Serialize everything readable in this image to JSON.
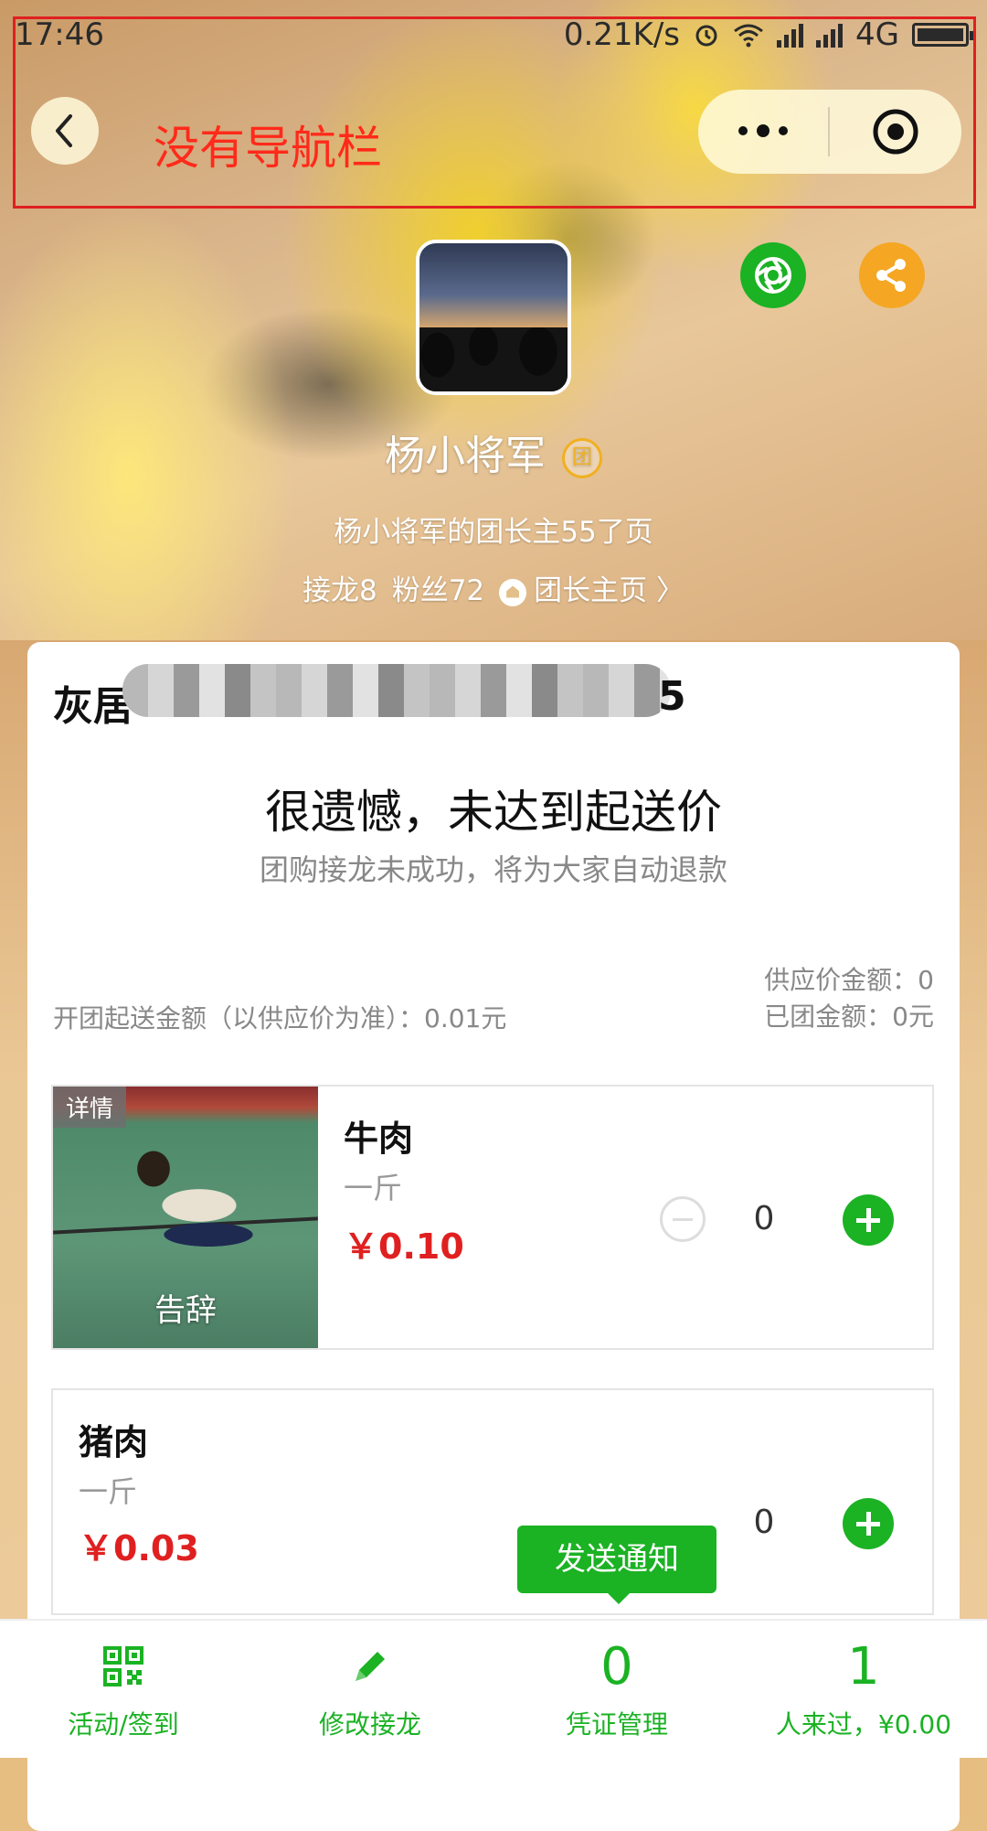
{
  "status_bar": {
    "time": "17:46",
    "speed": "0.21K/s",
    "network": "4G"
  },
  "annotation": {
    "text": "没有导航栏",
    "color": "#ff2a1a"
  },
  "profile": {
    "name": "杨小将军",
    "badge": "团",
    "description": "杨小将军的团长主55了页",
    "relay_count_label": "接龙8",
    "fans_label": "粉丝72",
    "home_link": "团长主页 〉"
  },
  "card": {
    "title_prefix": "灰居",
    "title_suffix": "5",
    "fail_title": "很遗憾，未达到起送价",
    "fail_subtitle": "团购接龙未成功，将为大家自动退款",
    "min_amount": "开团起送金额（以供应价为准）：0.01元",
    "supply_amount": "供应价金额：0",
    "grouped_amount": "已团金额：0元"
  },
  "products": [
    {
      "name": "牛肉",
      "unit": "一斤",
      "price": "￥0.10",
      "quantity": "0",
      "tag": "详情",
      "caption": "告辞"
    },
    {
      "name": "猪肉",
      "unit": "一斤",
      "price": "￥0.03",
      "quantity": "0"
    }
  ],
  "notify_button": "发送通知",
  "tabbar": {
    "items": [
      {
        "label": "活动/签到",
        "icon": "qr-code-icon"
      },
      {
        "label": "修改接龙",
        "icon": "pencil-icon"
      },
      {
        "label": "凭证管理",
        "value": "0"
      },
      {
        "label": "人来过，¥0.00",
        "value": "1"
      }
    ]
  },
  "colors": {
    "accent": "#1bb224",
    "price": "#e02020",
    "share": "#f5a623"
  }
}
